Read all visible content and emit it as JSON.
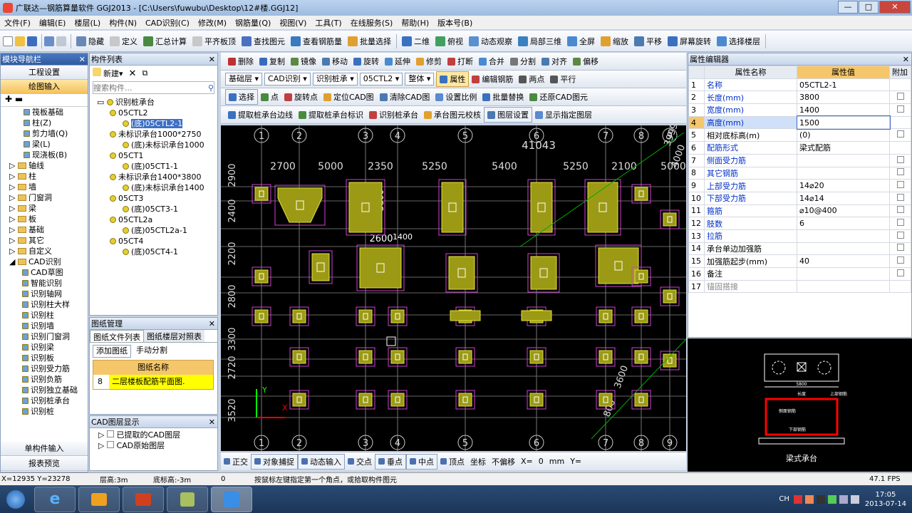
{
  "window": {
    "title": "广联达—钢筋算量软件 GGJ2013 - [C:\\Users\\fuwubu\\Desktop\\12#楼.GGJ12]",
    "min": "—",
    "max": "□",
    "close": "✕"
  },
  "menu": [
    "文件(F)",
    "编辑(E)",
    "楼层(L)",
    "构件(N)",
    "CAD识别(C)",
    "修改(M)",
    "钢筋量(Q)",
    "视图(V)",
    "工具(T)",
    "在线服务(S)",
    "帮助(H)",
    "版本号(B)"
  ],
  "toolbar": [
    "隐藏",
    "定义",
    "汇总计算",
    "平齐板顶",
    "查找图元",
    "查看钢筋量",
    "批量选择",
    "二维",
    "俯视",
    "动态观察",
    "局部三维",
    "全屏",
    "缩放",
    "平移",
    "屏幕旋转",
    "选择楼层"
  ],
  "left_nav": {
    "title": "模块导航栏",
    "project": "工程设置",
    "drawing": "绘图输入",
    "single": "单构件输入",
    "report": "报表预览",
    "items": [
      "筏板基础",
      "柱(Z)",
      "剪力墙(Q)",
      "梁(L)",
      "现浇板(B)",
      "轴线",
      "柱",
      "墙",
      "门窗洞",
      "梁",
      "板",
      "基础",
      "其它",
      "自定义",
      "CAD识别",
      "CAD草图",
      "智能识别",
      "识别轴网",
      "识别柱大样",
      "识别柱",
      "识别墙",
      "识别门窗洞",
      "识别梁",
      "识别板",
      "识别受力筋",
      "识别负筋",
      "识别独立基础",
      "识别桩承台",
      "识别桩"
    ]
  },
  "comp_list": {
    "title": "构件列表",
    "new": "新建",
    "search_placeholder": "搜索构件...",
    "tree": [
      "识别桩承台",
      "05CTL2",
      "(底)05CTL2-1",
      "未标识承台1000*2750",
      "(底)未标识承台1000",
      "05CT1",
      "(底)05CT1-1",
      "未标识承台1400*3800",
      "(底)未标识承台1400",
      "05CT3",
      "(底)05CT3-1",
      "05CTL2a",
      "(底)05CTL2a-1",
      "05CT4",
      "(底)05CT4-1"
    ]
  },
  "drawings": {
    "title": "图纸管理",
    "tab1": "图纸文件列表",
    "tab2": "图纸楼层对照表",
    "add": "添加图纸",
    "split": "手动分割",
    "col": "图纸名称",
    "row_num": "8",
    "row_name": "二层楼板配筋平面图."
  },
  "layers": {
    "title": "CAD图层显示",
    "l1": "已提取的CAD图层",
    "l2": "CAD原始图层"
  },
  "cad_tools": {
    "row1": [
      "删除",
      "复制",
      "镜像",
      "移动",
      "旋转",
      "延伸",
      "修剪",
      "打断",
      "合并",
      "分割",
      "对齐",
      "偏移"
    ],
    "row2_sel": [
      "基础层",
      "CAD识别",
      "识别桩承",
      "05CTL2",
      "整体"
    ],
    "row2_btn": [
      "属性",
      "编辑钢筋",
      "两点",
      "平行"
    ],
    "row3": [
      "选择",
      "点",
      "旋转点",
      "定位CAD图",
      "清除CAD图",
      "设置比例",
      "批量替换",
      "还原CAD图元"
    ],
    "row4": [
      "提取桩承台边线",
      "提取桩承台标识",
      "识别桩承台",
      "承台图元校核",
      "图层设置",
      "显示指定图层"
    ]
  },
  "cad_labels": {
    "axis_top": [
      "1",
      "2",
      "3",
      "4",
      "5",
      "6",
      "7",
      "8",
      "9"
    ],
    "dim_top": [
      "2700",
      "5000",
      "2350",
      "5250",
      "5400",
      "5250",
      "2100",
      "5000"
    ],
    "total": "41043",
    "dim_left": [
      "2900",
      "2400",
      "2200",
      "2800",
      "3300",
      "2720",
      "3520"
    ],
    "dim_small": [
      "3800",
      "2600",
      "1400"
    ],
    "right": [
      "3999",
      "4000",
      "3600",
      "800"
    ],
    "axis_y": "Y",
    "axis_x": "X"
  },
  "props": {
    "title": "属性编辑器",
    "h_name": "属性名称",
    "h_val": "属性值",
    "h_add": "附加",
    "rows": [
      [
        "1",
        "名称",
        "05CTL2-1"
      ],
      [
        "2",
        "长度(mm)",
        "3800"
      ],
      [
        "3",
        "宽度(mm)",
        "1400"
      ],
      [
        "4",
        "高度(mm)",
        "1500"
      ],
      [
        "5",
        "相对底标高(m)",
        "(0)"
      ],
      [
        "6",
        "配筋形式",
        "梁式配筋"
      ],
      [
        "7",
        "侧面受力筋",
        ""
      ],
      [
        "8",
        "其它钢筋",
        ""
      ],
      [
        "9",
        "上部受力筋",
        "14⌀20"
      ],
      [
        "10",
        "下部受力筋",
        "14⌀14"
      ],
      [
        "11",
        "箍筋",
        "⌀10@400"
      ],
      [
        "12",
        "肢数",
        "6"
      ],
      [
        "13",
        "拉筋",
        ""
      ],
      [
        "14",
        "承台单边加强筋",
        ""
      ],
      [
        "15",
        "加强筋起步(mm)",
        "40"
      ],
      [
        "16",
        "备注",
        ""
      ],
      [
        "17",
        "锚固搭接",
        ""
      ]
    ]
  },
  "preview": {
    "caption": "梁式承台",
    "w": "5800",
    "top": "上部钢筋",
    "bottom": "下部钢筋",
    "side": "侧面钢筋",
    "len": "长度"
  },
  "bottom": [
    "正交",
    "对象捕捉",
    "动态输入",
    "交点",
    "垂点",
    "中点",
    "顶点",
    "坐标",
    "不偏移",
    "X=",
    "0",
    "mm",
    "Y="
  ],
  "status": {
    "coords": "X=12935 Y=23278",
    "floor_h": "层高:3m",
    "base": "底标高:-3m",
    "zero": "0",
    "hint": "按鼠标左键指定第一个角点，或拾取构件图元",
    "fps": "47.1 FPS"
  },
  "tray": {
    "lang": "CH",
    "time": "17:05",
    "date": "2013-07-14"
  }
}
